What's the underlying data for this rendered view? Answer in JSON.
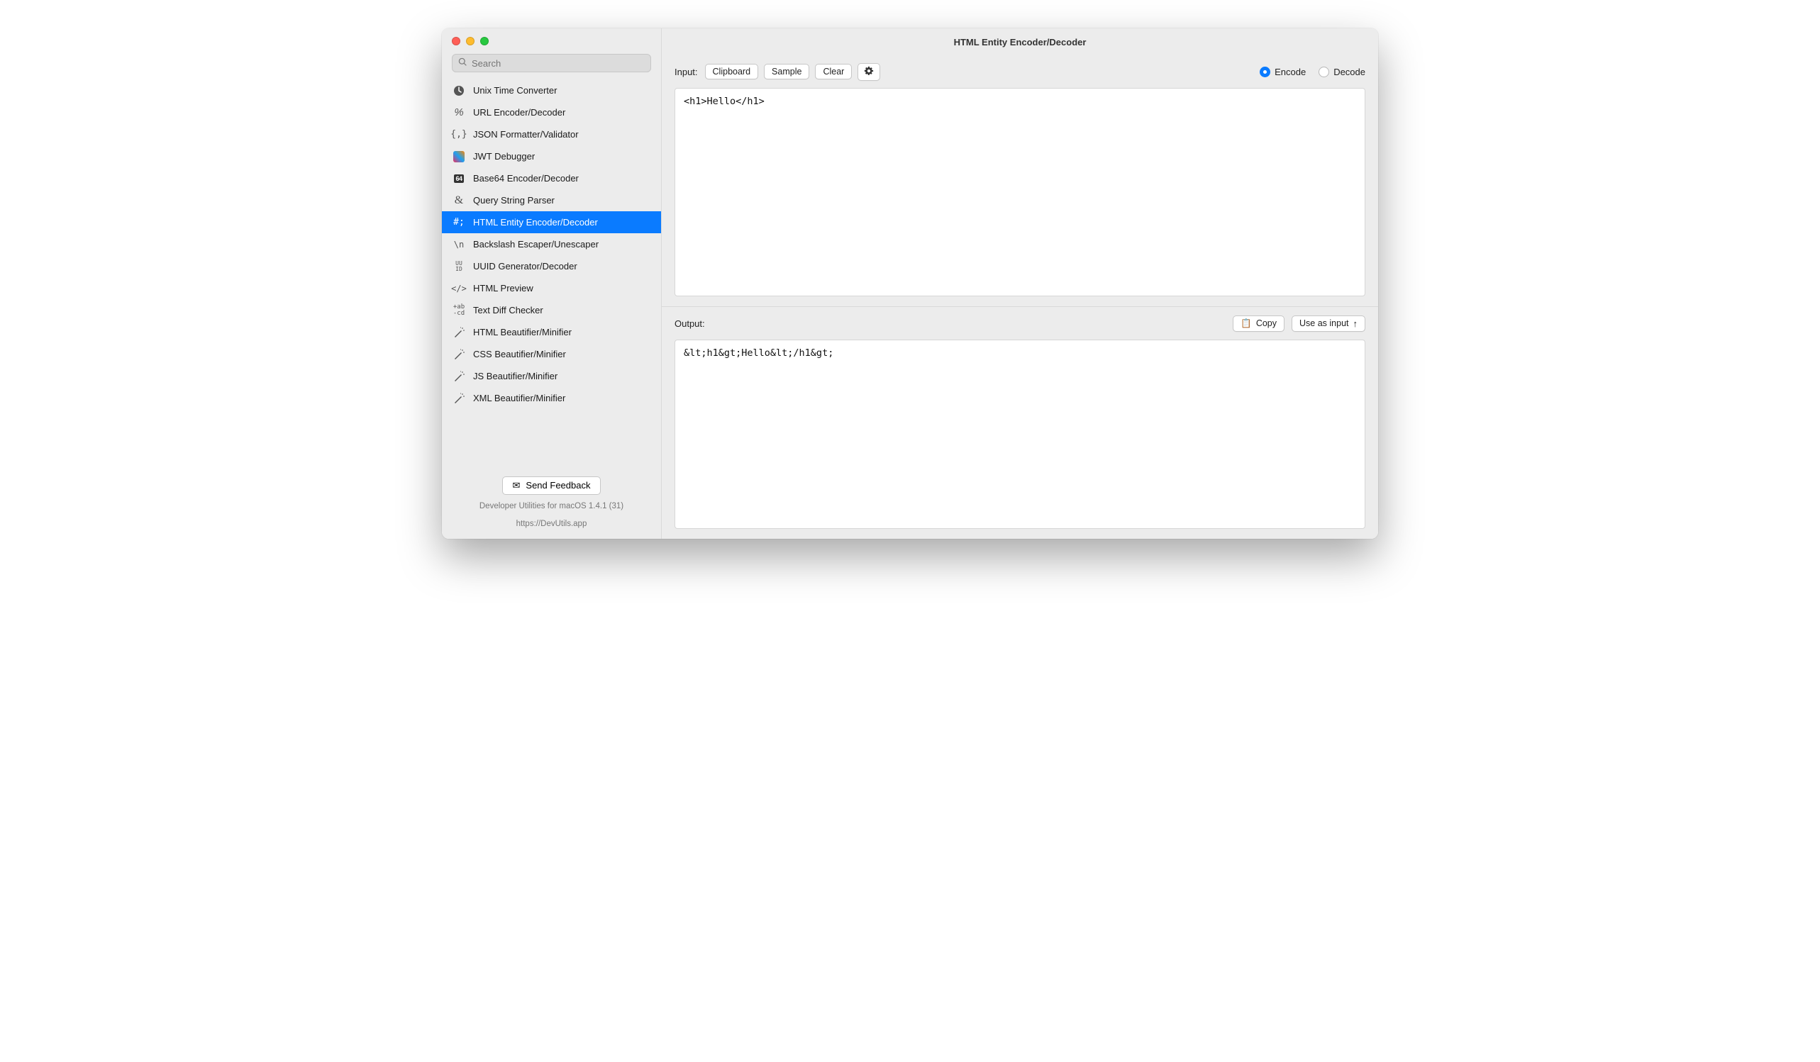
{
  "title": "HTML Entity Encoder/Decoder",
  "search": {
    "placeholder": "Search"
  },
  "sidebar": {
    "items": [
      {
        "label": "Unix Time Converter",
        "icon": "clock"
      },
      {
        "label": "URL Encoder/Decoder",
        "icon": "percent"
      },
      {
        "label": "JSON Formatter/Validator",
        "icon": "braces"
      },
      {
        "label": "JWT Debugger",
        "icon": "jwt"
      },
      {
        "label": "Base64 Encoder/Decoder",
        "icon": "base64"
      },
      {
        "label": "Query String Parser",
        "icon": "ampersand"
      },
      {
        "label": "HTML Entity Encoder/Decoder",
        "icon": "hash",
        "active": true
      },
      {
        "label": "Backslash Escaper/Unescaper",
        "icon": "backslash"
      },
      {
        "label": "UUID Generator/Decoder",
        "icon": "uuid"
      },
      {
        "label": "HTML Preview",
        "icon": "angle"
      },
      {
        "label": "Text Diff Checker",
        "icon": "diff"
      },
      {
        "label": "HTML Beautifier/Minifier",
        "icon": "wand"
      },
      {
        "label": "CSS Beautifier/Minifier",
        "icon": "wand"
      },
      {
        "label": "JS Beautifier/Minifier",
        "icon": "wand"
      },
      {
        "label": "XML Beautifier/Minifier",
        "icon": "wand"
      }
    ]
  },
  "footer": {
    "feedback": "Send Feedback",
    "line1": "Developer Utilities for macOS 1.4.1 (31)",
    "line2": "https://DevUtils.app"
  },
  "input_section": {
    "label": "Input:",
    "buttons": {
      "clipboard": "Clipboard",
      "sample": "Sample",
      "clear": "Clear"
    },
    "modes": {
      "encode": "Encode",
      "decode": "Decode",
      "selected": "encode"
    },
    "value": "<h1>Hello</h1>"
  },
  "output_section": {
    "label": "Output:",
    "buttons": {
      "copy": "Copy",
      "use_as_input": "Use as input"
    },
    "value": "&lt;h1&gt;Hello&lt;/h1&gt;"
  }
}
